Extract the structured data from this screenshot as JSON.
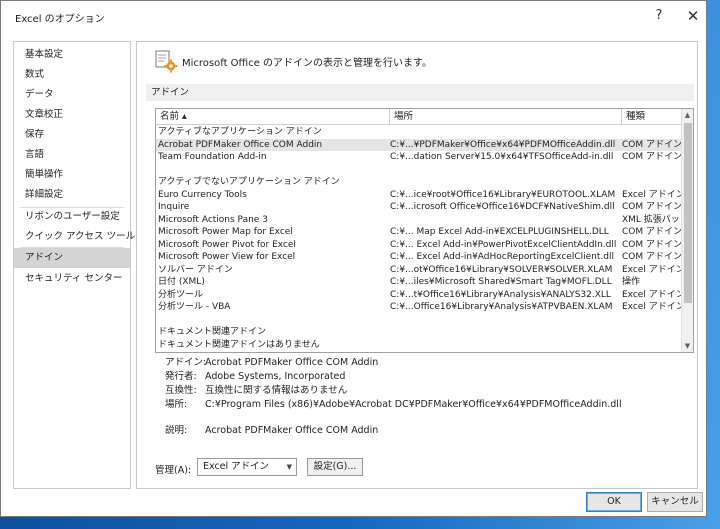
{
  "window": {
    "title": "Excel のオプション",
    "help_glyph": "?",
    "close_glyph": "✕"
  },
  "nav": {
    "items": [
      "基本設定",
      "数式",
      "データ",
      "文章校正",
      "保存",
      "言語",
      "簡単操作",
      "詳細設定",
      "リボンのユーザー設定",
      "クイック アクセス ツール バー",
      "アドイン",
      "セキュリティ センター"
    ],
    "active": "アドイン"
  },
  "header": {
    "text": "Microsoft Office のアドインの表示と管理を行います。"
  },
  "section": {
    "title": "アドイン"
  },
  "table": {
    "columns": [
      "名前 ▴",
      "場所",
      "種類"
    ],
    "rows": [
      {
        "name": "アクティブなアプリケーション アドイン",
        "location": "",
        "type": ""
      },
      {
        "name": "Acrobat PDFMaker Office COM Addin",
        "location": "C:¥...¥PDFMaker¥Office¥x64¥PDFMOfficeAddin.dll",
        "type": "COM アドイン"
      },
      {
        "name": "Team Foundation Add-in",
        "location": "C:¥...dation Server¥15.0¥x64¥TFSOfficeAdd-in.dll",
        "type": "COM アドイン"
      },
      {
        "name": "",
        "location": "",
        "type": ""
      },
      {
        "name": "アクティブでないアプリケーション アドイン",
        "location": "",
        "type": ""
      },
      {
        "name": "Euro Currency Tools",
        "location": "C:¥...ice¥root¥Office16¥Library¥EUROTOOL.XLAM",
        "type": "Excel アドイン"
      },
      {
        "name": "Inquire",
        "location": "C:¥...icrosoft Office¥Office16¥DCF¥NativeShim.dll",
        "type": "COM アドイン"
      },
      {
        "name": "Microsoft Actions Pane 3",
        "location": "",
        "type": "XML 拡張パック"
      },
      {
        "name": "Microsoft Power Map for Excel",
        "location": "C:¥... Map Excel Add-in¥EXCELPLUGINSHELL.DLL",
        "type": "COM アドイン"
      },
      {
        "name": "Microsoft Power Pivot for Excel",
        "location": "C:¥... Excel Add-in¥PowerPivotExcelClientAddIn.dll",
        "type": "COM アドイン"
      },
      {
        "name": "Microsoft Power View for Excel",
        "location": "C:¥... Excel Add-in¥AdHocReportingExcelClient.dll",
        "type": "COM アドイン"
      },
      {
        "name": "ソルバー アドイン",
        "location": "C:¥...ot¥Office16¥Library¥SOLVER¥SOLVER.XLAM",
        "type": "Excel アドイン"
      },
      {
        "name": "日付 (XML)",
        "location": "C:¥...iles¥Microsoft Shared¥Smart Tag¥MOFL.DLL",
        "type": "操作"
      },
      {
        "name": "分析ツール",
        "location": "C:¥...t¥Office16¥Library¥Analysis¥ANALYS32.XLL",
        "type": "Excel アドイン"
      },
      {
        "name": "分析ツール - VBA",
        "location": "C:¥...Office16¥Library¥Analysis¥ATPVBAEN.XLAM",
        "type": "Excel アドイン"
      },
      {
        "name": "",
        "location": "",
        "type": ""
      },
      {
        "name": "ドキュメント関連アドイン",
        "location": "",
        "type": ""
      },
      {
        "name": "ドキュメント関連アドインはありません",
        "location": "",
        "type": ""
      }
    ],
    "selected_index": 1
  },
  "details": {
    "addin_label": "アドイン:",
    "addin_value": "Acrobat PDFMaker Office COM Addin",
    "publisher_label": "発行者:",
    "publisher_value": "Adobe Systems, Incorporated",
    "compat_label": "互換性:",
    "compat_value": "互換性に関する情報はありません",
    "location_label": "場所:",
    "location_value": "C:¥Program Files (x86)¥Adobe¥Acrobat DC¥PDFMaker¥Office¥x64¥PDFMOfficeAddin.dll",
    "desc_label": "説明:",
    "desc_value": "Acrobat PDFMaker Office COM Addin"
  },
  "manage": {
    "label": "管理(A):",
    "selected": "Excel アドイン",
    "go_label": "設定(G)..."
  },
  "footer": {
    "ok_label": "OK",
    "cancel_label": "キャンセル"
  },
  "colors": {
    "accent": "#0078d7",
    "nav_active": "#d4d4d4",
    "section_bar": "#efefef"
  }
}
